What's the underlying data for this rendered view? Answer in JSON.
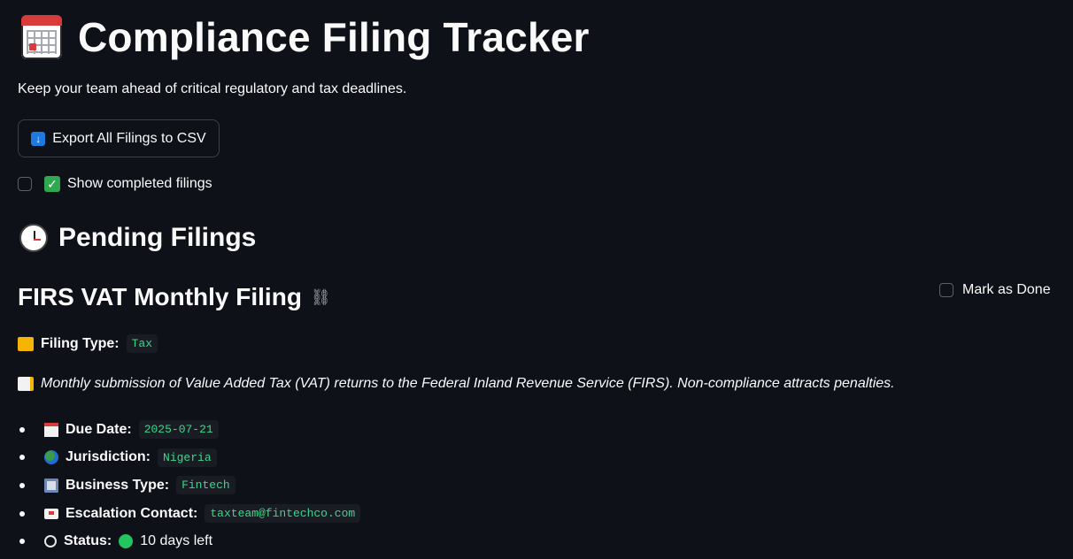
{
  "header": {
    "title": "Compliance Filing Tracker",
    "subtitle": "Keep your team ahead of critical regulatory and tax deadlines."
  },
  "actions": {
    "export_label": "Export All Filings to CSV"
  },
  "options": {
    "show_completed_label": "Show completed filings",
    "show_completed_checked": false
  },
  "section": {
    "title": "Pending Filings"
  },
  "filing": {
    "title": "FIRS VAT Monthly Filing",
    "mark_done_label": "Mark as Done",
    "mark_done_checked": false,
    "type_label": "Filing Type:",
    "type_value": "Tax",
    "description": "Monthly submission of Value Added Tax (VAT) returns to the Federal Inland Revenue Service (FIRS). Non-compliance attracts penalties.",
    "details": [
      {
        "icon": "calendar-icon",
        "label": "Due Date:",
        "value": "2025-07-21"
      },
      {
        "icon": "globe-icon",
        "label": "Jurisdiction:",
        "value": "Nigeria"
      },
      {
        "icon": "building-icon",
        "label": "Business Type:",
        "value": "Fintech"
      },
      {
        "icon": "envelope-icon",
        "label": "Escalation Contact:",
        "value": "taxteam@fintechco.com"
      },
      {
        "icon": "stopwatch-icon",
        "label": "Status:",
        "value": "10 days left",
        "status_color": "#22c55e"
      }
    ]
  }
}
